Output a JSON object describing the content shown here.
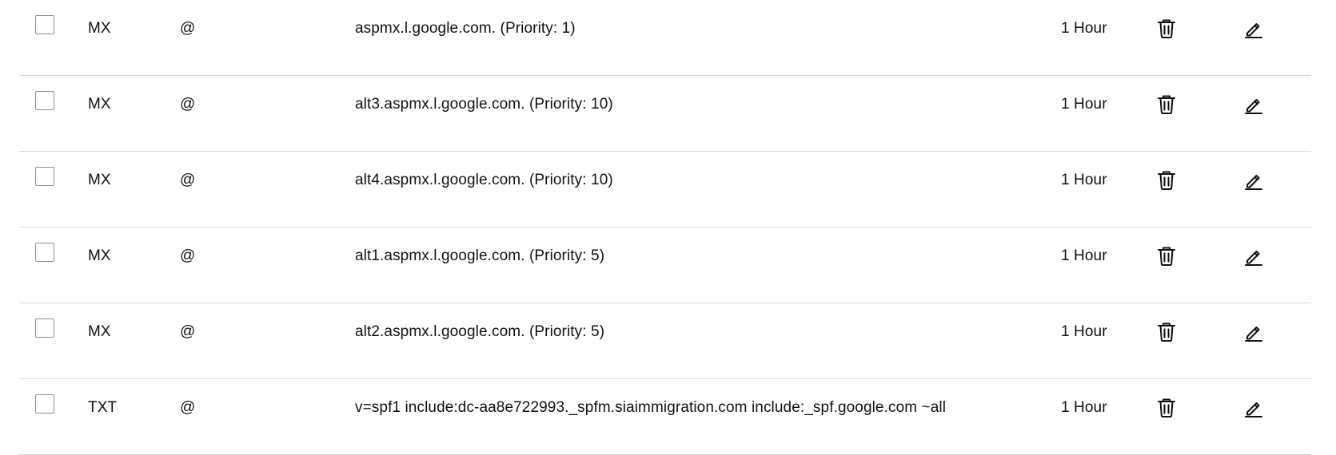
{
  "records": [
    {
      "type": "MX",
      "name": "@",
      "value": "aspmx.l.google.com. (Priority: 1)",
      "ttl": "1 Hour"
    },
    {
      "type": "MX",
      "name": "@",
      "value": "alt3.aspmx.l.google.com. (Priority: 10)",
      "ttl": "1 Hour"
    },
    {
      "type": "MX",
      "name": "@",
      "value": "alt4.aspmx.l.google.com. (Priority: 10)",
      "ttl": "1 Hour"
    },
    {
      "type": "MX",
      "name": "@",
      "value": "alt1.aspmx.l.google.com. (Priority: 5)",
      "ttl": "1 Hour"
    },
    {
      "type": "MX",
      "name": "@",
      "value": "alt2.aspmx.l.google.com. (Priority: 5)",
      "ttl": "1 Hour"
    },
    {
      "type": "TXT",
      "name": "@",
      "value": "v=spf1 include:dc-aa8e722993._spfm.siaimmigration.com include:_spf.google.com ~all",
      "ttl": "1 Hour"
    }
  ],
  "icons": {
    "delete": "trash-icon",
    "edit": "pencil-icon"
  },
  "colors": {
    "text": "#111111",
    "divider": "#d6d6d6",
    "checkbox_border": "#8d8d8d"
  }
}
